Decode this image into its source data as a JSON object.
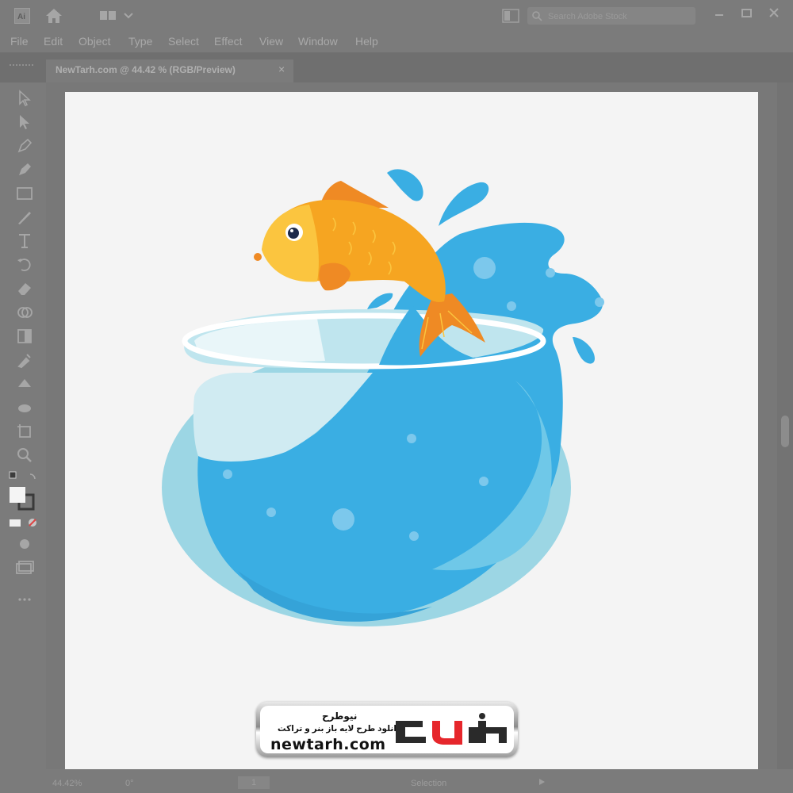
{
  "app": {
    "home_icon": "home-icon",
    "logo_icon": "illustrator-logo-icon"
  },
  "titlebar": {
    "search": {
      "placeholder": "Search Adobe Stock"
    },
    "window_controls": [
      "minimize-icon",
      "maximize-icon",
      "close-icon"
    ]
  },
  "menu": {
    "items": [
      {
        "label": "File"
      },
      {
        "label": "Edit"
      },
      {
        "label": "Object"
      },
      {
        "label": "Type"
      },
      {
        "label": "Select"
      },
      {
        "label": "Effect"
      },
      {
        "label": "View"
      },
      {
        "label": "Window"
      },
      {
        "label": "Help"
      }
    ]
  },
  "document": {
    "tab_title": "NewTarh.com @ 44.42 % (RGB/Preview)",
    "close_glyph": "×"
  },
  "toolbar": {
    "tools": [
      "selection-tool-icon",
      "direct-selection-tool-icon",
      "pen-tool-icon",
      "curvature-tool-icon",
      "rectangle-tool-icon",
      "paintbrush-tool-icon",
      "type-tool-icon",
      "rotate-tool-icon",
      "eraser-tool-icon",
      "shape-builder-tool-icon",
      "gradient-tool-icon",
      "eyedropper-tool-icon",
      "blend-tool-icon",
      "symbol-sprayer-tool-icon",
      "artboard-tool-icon",
      "zoom-tool-icon",
      "fill-stroke-icon",
      "draw-mode-icon",
      "screen-mode-icon",
      "more-tools-icon"
    ]
  },
  "artwork": {
    "colors": {
      "water": "#3aaee3",
      "bowl": "#9cd6e4",
      "fish": "#f6a521",
      "fish_head": "#fbc53f",
      "fin": "#ef8a24"
    }
  },
  "watermark": {
    "brand_fa": "نیوطرح",
    "tagline_fa": "دانلود طرح لایه باز بنر و تراکت",
    "url": "newtarh.com",
    "logo_fa": "نیوطرح",
    "logo_colors": {
      "dark": "#2a2a2a",
      "red": "#e6262b"
    }
  },
  "statusbar": {
    "zoom": "44.42%",
    "rotation": "0°",
    "artboard_number": "1",
    "mode": "Selection"
  }
}
